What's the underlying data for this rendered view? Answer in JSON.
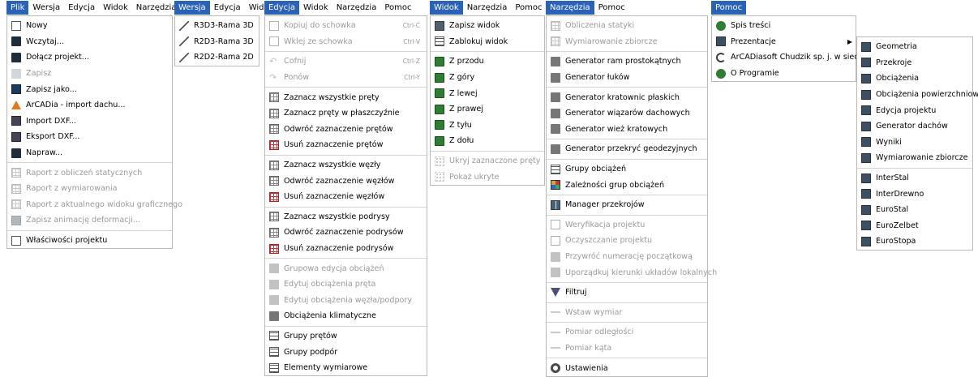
{
  "panels": [
    {
      "menubar": [
        "Plik",
        "Wersja",
        "Edycja",
        "Widok",
        "Narzędzia"
      ],
      "active": 0,
      "items": [
        {
          "label": "Nowy",
          "icon": "new-document-icon"
        },
        {
          "label": "Wczytaj...",
          "icon": "open-folder-icon"
        },
        {
          "label": "Dołącz projekt...",
          "icon": "attach-folder-icon"
        },
        {
          "label": "Zapisz",
          "icon": "save-icon",
          "disabled": true
        },
        {
          "label": "Zapisz jako...",
          "icon": "save-as-icon"
        },
        {
          "label": "ArCADia - import dachu...",
          "icon": "roof-import-icon"
        },
        {
          "label": "Import DXF...",
          "icon": "import-dxf-icon"
        },
        {
          "label": "Eksport DXF...",
          "icon": "export-dxf-icon"
        },
        {
          "label": "Napraw...",
          "icon": "repair-folder-icon"
        },
        {
          "sep": true
        },
        {
          "label": "Raport z obliczeń statycznych",
          "icon": "report-icon",
          "disabled": true
        },
        {
          "label": "Raport z wymiarowania",
          "icon": "report-icon",
          "disabled": true
        },
        {
          "label": "Raport z aktualnego widoku graficznego",
          "icon": "report-icon",
          "disabled": true
        },
        {
          "label": "Zapisz animację deformacji...",
          "icon": "save-animation-icon",
          "disabled": true
        },
        {
          "sep": true
        },
        {
          "label": "Właściwości projektu",
          "icon": "checkbox-icon"
        }
      ]
    },
    {
      "menubar": [
        "Wersja",
        "Edycja",
        "Widok"
      ],
      "active": 0,
      "items": [
        {
          "label": "R3D3-Rama 3D",
          "icon": "frame-3d-icon"
        },
        {
          "label": "R2D3-Rama 3D",
          "icon": "frame-3d-icon"
        },
        {
          "label": "R2D2-Rama 2D",
          "icon": "frame-2d-icon"
        }
      ]
    },
    {
      "menubar": [
        "Edycja",
        "Widok",
        "Narzędzia",
        "Pomoc"
      ],
      "active": 0,
      "items": [
        {
          "label": "Kopiuj do schowka",
          "icon": "copy-icon",
          "disabled": true,
          "shortcut": "Ctrl-C"
        },
        {
          "label": "Wklej ze schowka",
          "icon": "paste-icon",
          "disabled": true,
          "shortcut": "Ctrl-V"
        },
        {
          "sep": true
        },
        {
          "label": "Cofnij",
          "icon": "undo-icon",
          "disabled": true,
          "shortcut": "Ctrl-Z"
        },
        {
          "label": "Ponów",
          "icon": "redo-icon",
          "disabled": true,
          "shortcut": "Ctrl-Y"
        },
        {
          "sep": true
        },
        {
          "label": "Zaznacz wszystkie pręty",
          "icon": "select-all-bars-icon"
        },
        {
          "label": "Zaznacz pręty w płaszczyźnie",
          "icon": "select-plane-icon"
        },
        {
          "label": "Odwróć zaznaczenie prętów",
          "icon": "invert-bars-icon"
        },
        {
          "label": "Usuń zaznaczenie prętów",
          "icon": "clear-bars-icon"
        },
        {
          "sep": true
        },
        {
          "label": "Zaznacz wszystkie węzły",
          "icon": "select-nodes-icon"
        },
        {
          "label": "Odwróć zaznaczenie węzłów",
          "icon": "invert-nodes-icon"
        },
        {
          "label": "Usuń zaznaczenie węzłów",
          "icon": "clear-nodes-icon"
        },
        {
          "sep": true
        },
        {
          "label": "Zaznacz wszystkie podrysy",
          "icon": "select-sub-icon"
        },
        {
          "label": "Odwróć zaznaczenie podrysów",
          "icon": "invert-sub-icon"
        },
        {
          "label": "Usuń zaznaczenie podrysów",
          "icon": "clear-sub-icon"
        },
        {
          "sep": true
        },
        {
          "label": "Grupowa edycja obciążeń",
          "icon": "group-loads-icon",
          "disabled": true
        },
        {
          "label": "Edytuj obciążenia pręta",
          "icon": "bar-loads-icon",
          "disabled": true
        },
        {
          "label": "Edytuj obciążenia węzła/podpory",
          "icon": "node-loads-icon",
          "disabled": true
        },
        {
          "label": "Obciążenia klimatyczne",
          "icon": "climate-icon"
        },
        {
          "sep": true
        },
        {
          "label": "Grupy prętów",
          "icon": "bar-groups-icon"
        },
        {
          "label": "Grupy podpór",
          "icon": "support-groups-icon"
        },
        {
          "label": "Elementy wymiarowe",
          "icon": "dimension-elements-icon"
        }
      ]
    },
    {
      "menubar": [
        "Widok",
        "Narzędzia",
        "Pomoc"
      ],
      "active": 0,
      "items": [
        {
          "label": "Zapisz widok",
          "icon": "save-view-icon"
        },
        {
          "label": "Zablokuj widok",
          "icon": "lock-view-icon"
        },
        {
          "sep": true
        },
        {
          "label": "Z przodu",
          "icon": "view-cube-icon"
        },
        {
          "label": "Z góry",
          "icon": "view-cube-icon"
        },
        {
          "label": "Z lewej",
          "icon": "view-cube-icon"
        },
        {
          "label": "Z prawej",
          "icon": "view-cube-icon"
        },
        {
          "label": "Z tyłu",
          "icon": "view-cube-icon"
        },
        {
          "label": "Z dołu",
          "icon": "view-cube-icon"
        },
        {
          "sep": true
        },
        {
          "label": "Ukryj zaznaczone pręty",
          "icon": "hide-bars-icon",
          "disabled": true
        },
        {
          "label": "Pokaż ukryte",
          "icon": "show-hidden-icon",
          "disabled": true
        }
      ]
    },
    {
      "menubar": [
        "Narzędzia",
        "Pomoc"
      ],
      "active": 0,
      "items": [
        {
          "label": "Obliczenia statyki",
          "icon": "statics-icon",
          "disabled": true
        },
        {
          "label": "Wymiarowanie zbiorcze",
          "icon": "batch-dimension-icon",
          "disabled": true
        },
        {
          "sep": true
        },
        {
          "label": "Generator ram prostokątnych",
          "icon": "rect-frame-generator-icon"
        },
        {
          "label": "Generator łuków",
          "icon": "arch-generator-icon"
        },
        {
          "sep": true
        },
        {
          "label": "Generator kratownic płaskich",
          "icon": "truss-generator-icon"
        },
        {
          "label": "Generator wiązarów dachowych",
          "icon": "roof-truss-generator-icon"
        },
        {
          "label": "Generator wież kratowych",
          "icon": "tower-generator-icon"
        },
        {
          "sep": true
        },
        {
          "label": "Generator przekryć geodezyjnych",
          "icon": "geodesic-generator-icon"
        },
        {
          "sep": true
        },
        {
          "label": "Grupy obciążeń",
          "icon": "load-groups-icon"
        },
        {
          "label": "Zależności grup obciążeń",
          "icon": "load-dependencies-icon"
        },
        {
          "sep": true
        },
        {
          "label": "Manager przekrojów",
          "icon": "section-manager-icon"
        },
        {
          "sep": true
        },
        {
          "label": "Weryfikacja projektu",
          "icon": "verify-icon",
          "disabled": true
        },
        {
          "label": "Oczyszczanie projektu",
          "icon": "cleanup-icon",
          "disabled": true
        },
        {
          "label": "Przywróć numerację początkową",
          "icon": "renumber-icon",
          "disabled": true
        },
        {
          "label": "Uporządkuj kierunki układów lokalnych",
          "icon": "local-axes-icon",
          "disabled": true
        },
        {
          "sep": true
        },
        {
          "label": "Filtruj",
          "icon": "filter-icon"
        },
        {
          "sep": true
        },
        {
          "label": "Wstaw wymiar",
          "icon": "insert-dimension-icon",
          "disabled": true
        },
        {
          "sep": true
        },
        {
          "label": "Pomiar odległości",
          "icon": "measure-distance-icon",
          "disabled": true
        },
        {
          "label": "Pomiar kąta",
          "icon": "measure-angle-icon",
          "disabled": true
        },
        {
          "sep": true
        },
        {
          "label": "Ustawienia",
          "icon": "settings-icon"
        }
      ]
    },
    {
      "menubar": [
        "Pomoc"
      ],
      "active": 0,
      "items": [
        {
          "label": "Spis treści",
          "icon": "help-icon"
        },
        {
          "label": "Prezentacje",
          "icon": "presentation-icon",
          "submenu": true
        },
        {
          "label": "ArCADiasoft Chudzik sp. j. w sieci",
          "icon": "web-icon"
        },
        {
          "label": "O Programie",
          "icon": "info-icon"
        }
      ]
    },
    {
      "menubar": [],
      "active": -1,
      "items": [
        {
          "label": "Geometria",
          "icon": "book-icon"
        },
        {
          "label": "Przekroje",
          "icon": "book-icon"
        },
        {
          "label": "Obciążenia",
          "icon": "book-icon"
        },
        {
          "label": "Obciążenia powierzchniowe",
          "icon": "book-icon"
        },
        {
          "label": "Edycja projektu",
          "icon": "book-icon"
        },
        {
          "label": "Generator dachów",
          "icon": "book-icon"
        },
        {
          "label": "Wyniki",
          "icon": "book-icon"
        },
        {
          "label": "Wymiarowanie zbiorcze",
          "icon": "book-icon"
        },
        {
          "sep": true
        },
        {
          "label": "InterStal",
          "icon": "book-icon"
        },
        {
          "label": "InterDrewno",
          "icon": "book-icon"
        },
        {
          "label": "EuroStal",
          "icon": "book-icon"
        },
        {
          "label": "EuroZelbet",
          "icon": "book-icon"
        },
        {
          "label": "EuroStopa",
          "icon": "book-icon"
        }
      ]
    }
  ]
}
